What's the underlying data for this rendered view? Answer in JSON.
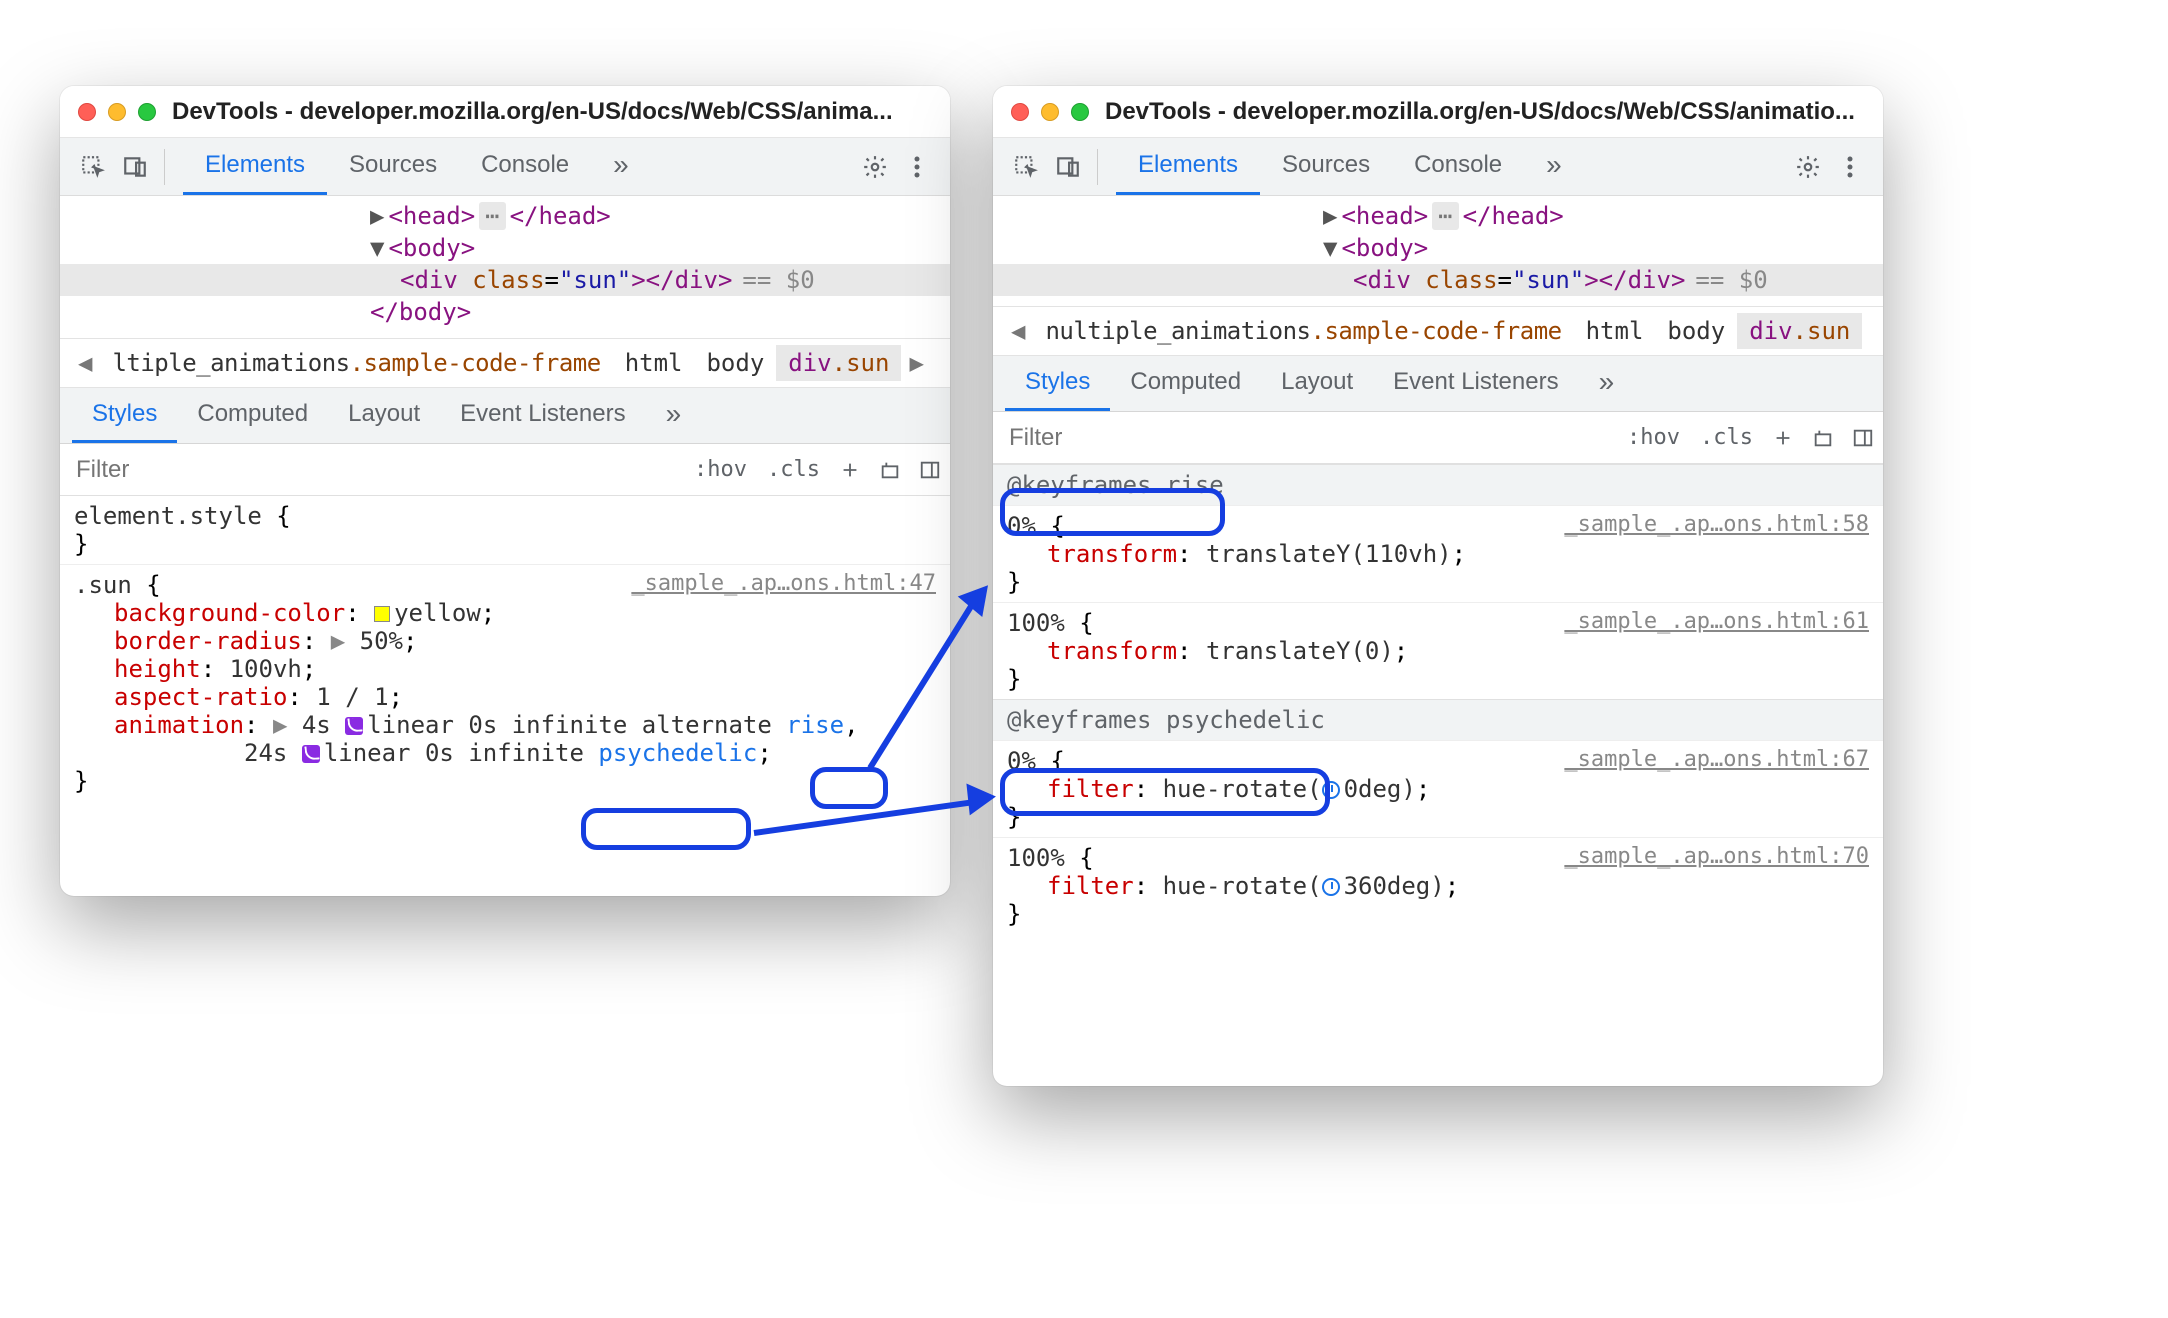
{
  "windows": {
    "left": {
      "title": "DevTools - developer.mozilla.org/en-US/docs/Web/CSS/anima...",
      "tabs": {
        "elements": "Elements",
        "sources": "Sources",
        "console": "Console"
      },
      "dom": {
        "head_open": "<head>",
        "head_close": "</head>",
        "body_open": "<body>",
        "body_close": "</body>",
        "div_tag": "div",
        "div_attr": "class",
        "div_val": "\"sun\"",
        "eq0": "== $0"
      },
      "breadcrumb": {
        "trunc": "ltiple_animations",
        "cls": ".sample-code-frame",
        "items": [
          "html",
          "body",
          "div.sun"
        ]
      },
      "subtabs": {
        "styles": "Styles",
        "computed": "Computed",
        "layout": "Layout",
        "evt": "Event Listeners"
      },
      "filter": {
        "placeholder": "Filter",
        "hov": ":hov",
        "cls": ".cls"
      },
      "styles": {
        "element_style": "element.style",
        "sun_selector": ".sun",
        "sun_src": "_sample_.ap…ons.html:47",
        "props": {
          "bg_name": "background-color",
          "bg_val": "yellow",
          "br_name": "border-radius",
          "br_val": "50%",
          "h_name": "height",
          "h_val": "100vh",
          "ar_name": "aspect-ratio",
          "ar_val": "1 / 1",
          "anim_name": "animation",
          "anim1_dur": "4s",
          "anim1_timing": "linear",
          "anim1_delay": "0s",
          "anim1_iter": "infinite",
          "anim1_dir": "alternate",
          "anim1_kf": "rise",
          "anim2_dur": "24s",
          "anim2_timing": "linear",
          "anim2_delay": "0s",
          "anim2_iter": "infinite",
          "anim2_kf": "psychedelic"
        }
      }
    },
    "right": {
      "title": "DevTools - developer.mozilla.org/en-US/docs/Web/CSS/animatio...",
      "tabs": {
        "elements": "Elements",
        "sources": "Sources",
        "console": "Console"
      },
      "dom": {
        "head_open": "<head>",
        "head_close": "</head>",
        "body_open": "<body>",
        "body_close": "</body>",
        "div_tag": "div",
        "div_attr": "class",
        "div_val": "\"sun\"",
        "eq0": "== $0"
      },
      "breadcrumb": {
        "trunc": "nultiple_animations",
        "cls": ".sample-code-frame",
        "items": [
          "html",
          "body",
          "div.sun"
        ]
      },
      "subtabs": {
        "styles": "Styles",
        "computed": "Computed",
        "layout": "Layout",
        "evt": "Event Listeners"
      },
      "filter": {
        "placeholder": "Filter",
        "hov": ":hov",
        "cls": ".cls"
      },
      "keyframes": {
        "rise": {
          "header": "@keyframes rise",
          "f0_pct": "0%",
          "f0_src": "_sample_.ap…ons.html:58",
          "f0_prop": "transform",
          "f0_val": "translateY(110vh)",
          "f100_pct": "100%",
          "f100_src": "_sample_.ap…ons.html:61",
          "f100_prop": "transform",
          "f100_val": "translateY(0)"
        },
        "psy": {
          "header": "@keyframes psychedelic",
          "f0_pct": "0%",
          "f0_src": "_sample_.ap…ons.html:67",
          "f0_prop": "filter",
          "f0_val_pre": "hue-rotate(",
          "f0_deg": "0deg",
          "f0_val_post": ")",
          "f100_pct": "100%",
          "f100_src": "_sample_.ap…ons.html:70",
          "f100_prop": "filter",
          "f100_val_pre": "hue-rotate(",
          "f100_deg": "360deg",
          "f100_val_post": ")"
        }
      }
    }
  }
}
